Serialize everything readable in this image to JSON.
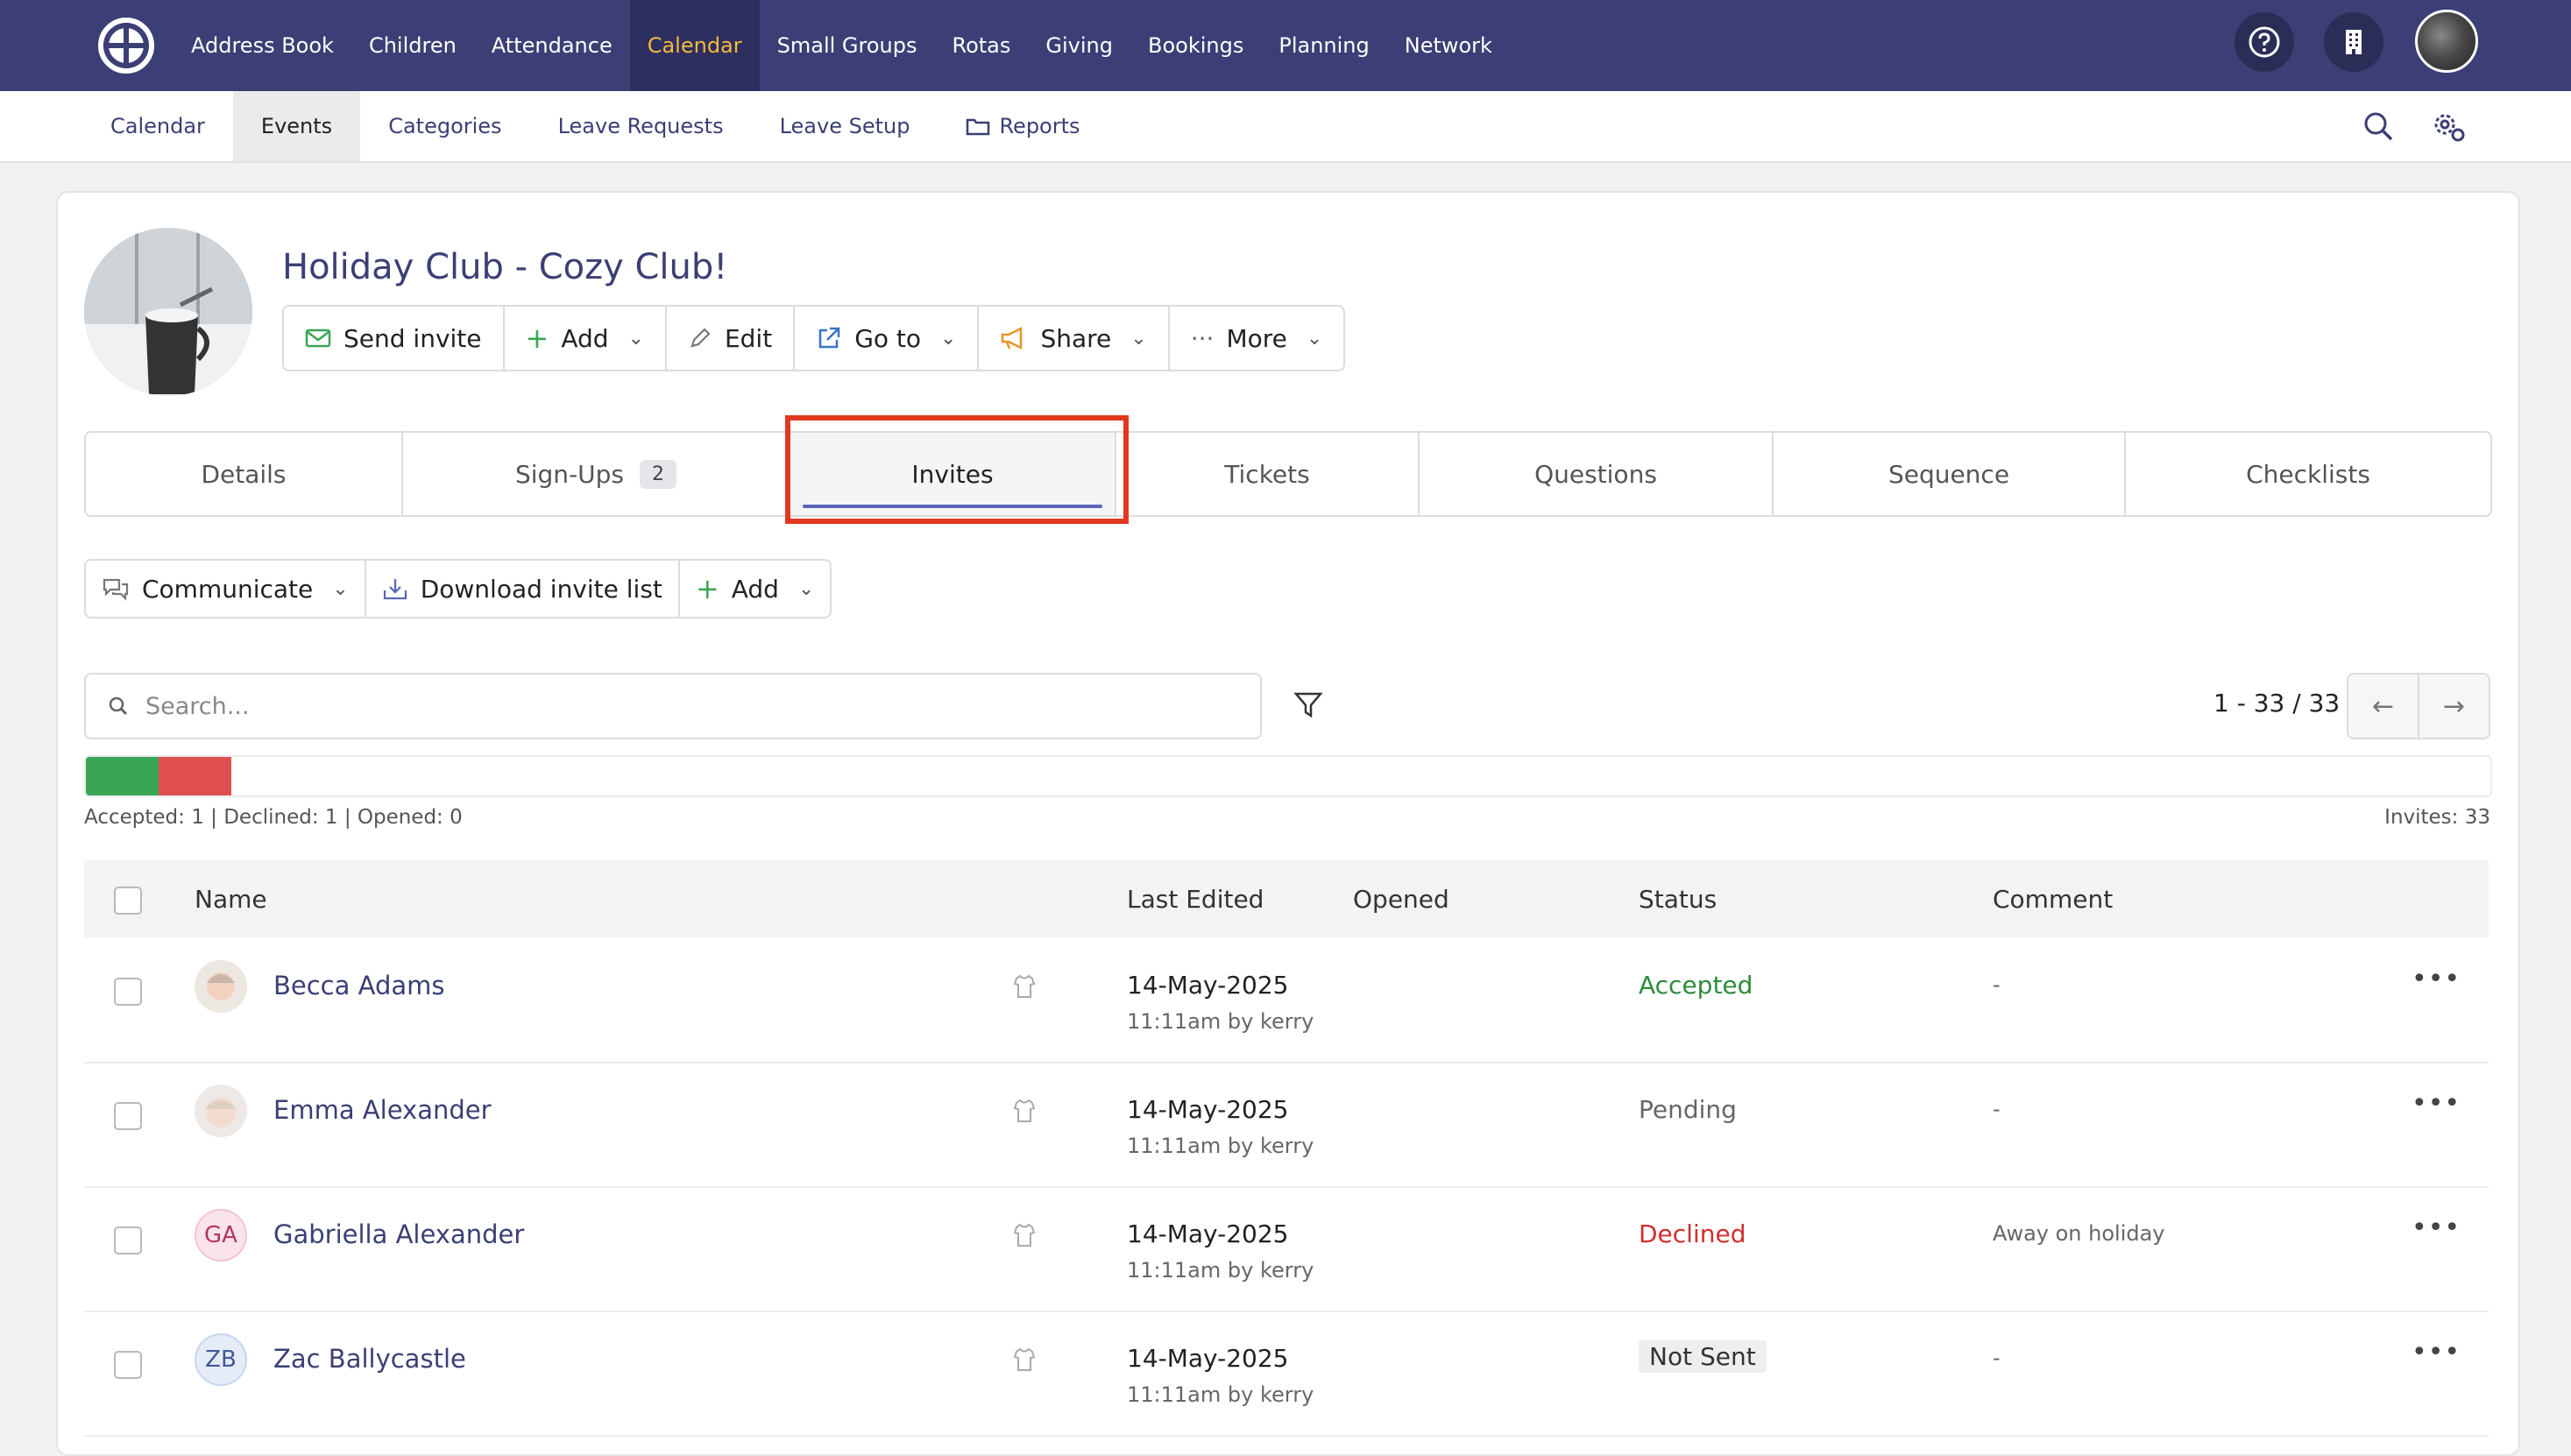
{
  "topnav": {
    "items": [
      {
        "label": "Address Book"
      },
      {
        "label": "Children"
      },
      {
        "label": "Attendance"
      },
      {
        "label": "Calendar",
        "active": true
      },
      {
        "label": "Small Groups"
      },
      {
        "label": "Rotas"
      },
      {
        "label": "Giving"
      },
      {
        "label": "Bookings"
      },
      {
        "label": "Planning"
      },
      {
        "label": "Network"
      }
    ],
    "icons": [
      "help-icon",
      "building-icon",
      "user-avatar"
    ]
  },
  "subnav": {
    "items": [
      {
        "label": "Calendar"
      },
      {
        "label": "Events",
        "active": true
      },
      {
        "label": "Categories"
      },
      {
        "label": "Leave Requests"
      },
      {
        "label": "Leave Setup"
      },
      {
        "label": "Reports",
        "icon": "folder-icon"
      }
    ],
    "icons": [
      "search-icon",
      "settings-icon"
    ]
  },
  "event": {
    "title": "Holiday Club - Cozy Club!",
    "actions": {
      "send_invite": "Send invite",
      "add": "Add",
      "edit": "Edit",
      "go_to": "Go to",
      "share": "Share",
      "more": "More"
    }
  },
  "tabs": [
    {
      "label": "Details"
    },
    {
      "label": "Sign-Ups",
      "badge": "2"
    },
    {
      "label": "Invites",
      "active": true
    },
    {
      "label": "Tickets"
    },
    {
      "label": "Questions"
    },
    {
      "label": "Sequence"
    },
    {
      "label": "Checklists"
    }
  ],
  "toolbar": {
    "communicate": "Communicate",
    "download": "Download invite list",
    "add": "Add"
  },
  "search": {
    "placeholder": "Search...",
    "value": ""
  },
  "pagination": {
    "range": "1 - 33",
    "total": "33",
    "text": "1 - 33 / 33"
  },
  "progress": {
    "accepted_fraction": 0.0303,
    "declined_fraction": 0.0303,
    "accepted_color": "#3aa655",
    "declined_color": "#e05050"
  },
  "stats": {
    "summary": "Accepted: 1 | Declined: 1 | Opened: 0",
    "invites": "Invites: 33"
  },
  "table": {
    "columns": {
      "name": "Name",
      "last_edited": "Last Edited",
      "opened": "Opened",
      "status": "Status",
      "comment": "Comment"
    },
    "rows": [
      {
        "name": "Becca Adams",
        "initials": "",
        "date": "14-May-2025",
        "edited": "11:11am by kerry",
        "opened": "",
        "status": "Accepted",
        "status_color": "#2e8b3a",
        "comment": "-"
      },
      {
        "name": "Emma Alexander",
        "initials": "",
        "date": "14-May-2025",
        "edited": "11:11am by kerry",
        "opened": "",
        "status": "Pending",
        "status_color": "#666666",
        "comment": "-"
      },
      {
        "name": "Gabriella Alexander",
        "initials": "GA",
        "date": "14-May-2025",
        "edited": "11:11am by kerry",
        "opened": "",
        "status": "Declined",
        "status_color": "#d22f2f",
        "comment": "Away on holiday"
      },
      {
        "name": "Zac Ballycastle",
        "initials": "ZB",
        "date": "14-May-2025",
        "edited": "11:11am by kerry",
        "opened": "",
        "status": "Not Sent",
        "status_color": "#333333",
        "comment": "-"
      }
    ]
  }
}
